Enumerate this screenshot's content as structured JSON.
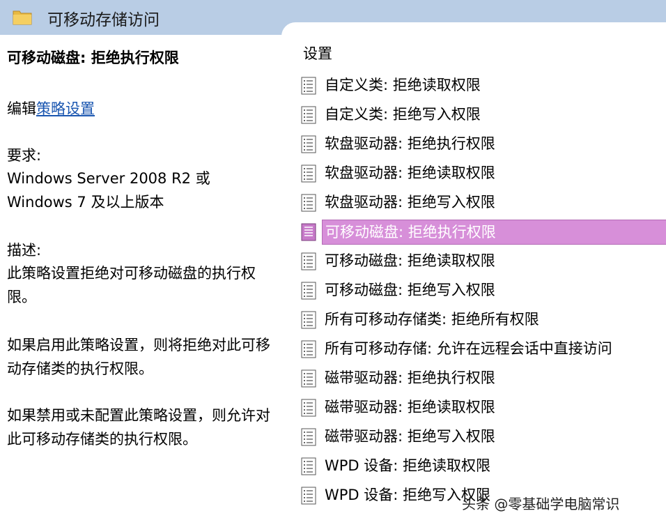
{
  "header": {
    "title": "可移动存储访问",
    "icon": "folder-icon"
  },
  "left": {
    "policy_title": "可移动磁盘: 拒绝执行权限",
    "edit_prefix": "编辑",
    "edit_link": "策略设置",
    "requirements_label": "要求:",
    "requirements_line1": "Windows Server 2008 R2 或",
    "requirements_line2": "Windows 7 及以上版本",
    "description_label": "描述:",
    "description_text": "此策略设置拒绝对可移动磁盘的执行权限。",
    "enabled_text": "如果启用此策略设置，则将拒绝对此可移动存储类的执行权限。",
    "disabled_text": "如果禁用或未配置此策略设置，则允许对此可移动存储类的执行权限。"
  },
  "right": {
    "header": "设置",
    "items": [
      {
        "label": "自定义类: 拒绝读取权限"
      },
      {
        "label": "自定义类: 拒绝写入权限"
      },
      {
        "label": "软盘驱动器: 拒绝执行权限"
      },
      {
        "label": "软盘驱动器: 拒绝读取权限"
      },
      {
        "label": "软盘驱动器: 拒绝写入权限"
      },
      {
        "label": "可移动磁盘: 拒绝执行权限",
        "selected": true
      },
      {
        "label": "可移动磁盘: 拒绝读取权限"
      },
      {
        "label": "可移动磁盘: 拒绝写入权限"
      },
      {
        "label": "所有可移动存储类: 拒绝所有权限"
      },
      {
        "label": "所有可移动存储: 允许在远程会话中直接访问"
      },
      {
        "label": "磁带驱动器: 拒绝执行权限"
      },
      {
        "label": "磁带驱动器: 拒绝读取权限"
      },
      {
        "label": "磁带驱动器: 拒绝写入权限"
      },
      {
        "label": "WPD 设备: 拒绝读取权限"
      },
      {
        "label": "WPD 设备: 拒绝写入权限"
      }
    ]
  },
  "watermark": "头条 @零基础学电脑常识",
  "colors": {
    "header_bg": "#b9cde5",
    "selected_bg": "#d78fd9",
    "link": "#1a56b0"
  }
}
